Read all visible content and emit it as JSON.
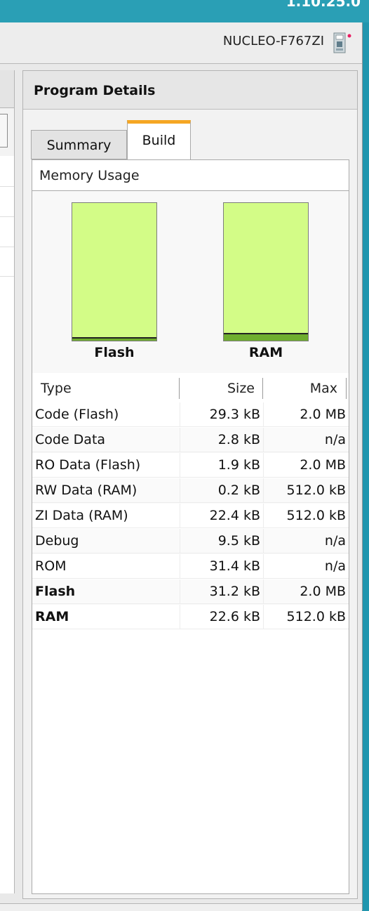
{
  "window": {
    "version": "1.10.25.0"
  },
  "header": {
    "device_name": "NUCLEO-F767ZI",
    "device_icon": "board-icon"
  },
  "panel": {
    "title": "Program Details",
    "tabs": [
      {
        "label": "Summary",
        "active": false
      },
      {
        "label": "Build",
        "active": true
      }
    ],
    "active_tab_accent": "#f5a623"
  },
  "memory": {
    "title": "Memory Usage",
    "bars": [
      {
        "label": "Flash",
        "used_fraction": 0.015,
        "fill_color": "#d3fc87",
        "used_color": "#6fae2e"
      },
      {
        "label": "RAM",
        "used_fraction": 0.044,
        "fill_color": "#d3fc87",
        "used_color": "#6fae2e"
      }
    ]
  },
  "table": {
    "headers": {
      "type": "Type",
      "size": "Size",
      "max": "Max"
    },
    "rows": [
      {
        "type": "Code (Flash)",
        "size": "29.3 kB",
        "max": "2.0 MB",
        "bold": false
      },
      {
        "type": "Code Data",
        "size": "2.8 kB",
        "max": "n/a",
        "bold": false
      },
      {
        "type": "RO Data (Flash)",
        "size": "1.9 kB",
        "max": "2.0 MB",
        "bold": false
      },
      {
        "type": "RW Data (RAM)",
        "size": "0.2 kB",
        "max": "512.0 kB",
        "bold": false
      },
      {
        "type": "ZI Data (RAM)",
        "size": "22.4 kB",
        "max": "512.0 kB",
        "bold": false
      },
      {
        "type": "Debug",
        "size": "9.5 kB",
        "max": "n/a",
        "bold": false
      },
      {
        "type": "ROM",
        "size": "31.4 kB",
        "max": "n/a",
        "bold": false
      },
      {
        "type": "Flash",
        "size": "31.2 kB",
        "max": "2.0 MB",
        "bold": true
      },
      {
        "type": "RAM",
        "size": "22.6 kB",
        "max": "512.0 kB",
        "bold": true
      }
    ]
  }
}
